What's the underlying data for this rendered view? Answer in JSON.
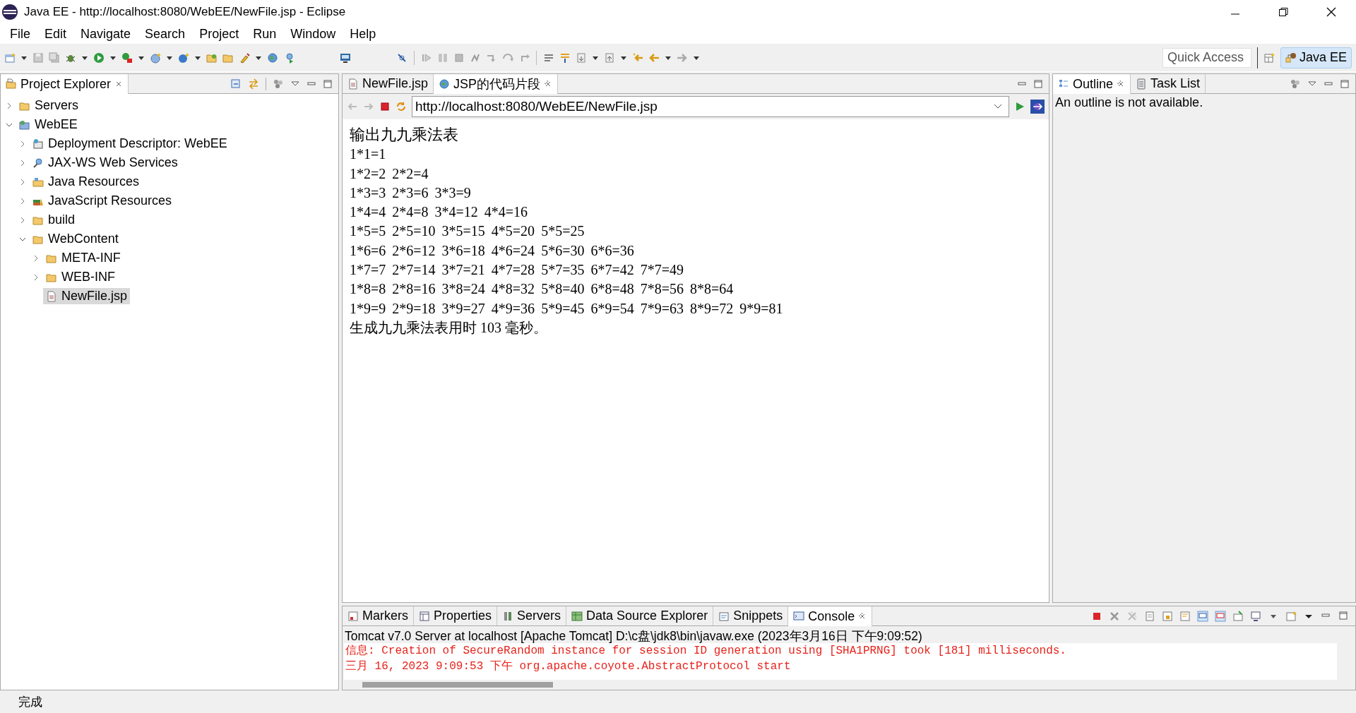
{
  "window": {
    "title": "Java EE - http://localhost:8080/WebEE/NewFile.jsp - Eclipse"
  },
  "menu": [
    "File",
    "Edit",
    "Navigate",
    "Search",
    "Project",
    "Run",
    "Window",
    "Help"
  ],
  "quick_access": {
    "placeholder": "Quick Access"
  },
  "perspective": {
    "label": "Java EE",
    "selected": true
  },
  "project_explorer": {
    "tab": "Project Explorer",
    "tree": [
      {
        "label": "Servers",
        "kind": "folder",
        "expanded": false,
        "selected": false
      },
      {
        "label": "WebEE",
        "kind": "project",
        "expanded": true,
        "selected": false,
        "children": [
          {
            "label": "Deployment Descriptor: WebEE",
            "kind": "descriptor",
            "expanded": false,
            "selected": false
          },
          {
            "label": "JAX-WS Web Services",
            "kind": "webservice",
            "expanded": false,
            "selected": false
          },
          {
            "label": "Java Resources",
            "kind": "java",
            "expanded": false,
            "selected": false
          },
          {
            "label": "JavaScript Resources",
            "kind": "script",
            "expanded": false,
            "selected": false
          },
          {
            "label": "build",
            "kind": "folder",
            "expanded": false,
            "selected": false
          },
          {
            "label": "WebContent",
            "kind": "folder",
            "expanded": true,
            "selected": false,
            "children": [
              {
                "label": "META-INF",
                "kind": "folder",
                "expanded": false,
                "selected": false
              },
              {
                "label": "WEB-INF",
                "kind": "folder",
                "expanded": false,
                "selected": false
              },
              {
                "label": "NewFile.jsp",
                "kind": "file",
                "selected": true
              }
            ]
          }
        ]
      }
    ]
  },
  "editor": {
    "tabs": [
      {
        "label": "NewFile.jsp",
        "selected": false
      },
      {
        "label": "JSP的代码片段",
        "selected": true
      }
    ],
    "url": "http://localhost:8080/WebEE/NewFile.jsp",
    "page": {
      "heading": "输出九九乘法表",
      "rows": [
        [
          "1*1=1"
        ],
        [
          "1*2=2",
          "2*2=4"
        ],
        [
          "1*3=3",
          "2*3=6",
          "3*3=9"
        ],
        [
          "1*4=4",
          "2*4=8",
          "3*4=12",
          "4*4=16"
        ],
        [
          "1*5=5",
          "2*5=10",
          "3*5=15",
          "4*5=20",
          "5*5=25"
        ],
        [
          "1*6=6",
          "2*6=12",
          "3*6=18",
          "4*6=24",
          "5*6=30",
          "6*6=36"
        ],
        [
          "1*7=7",
          "2*7=14",
          "3*7=21",
          "4*7=28",
          "5*7=35",
          "6*7=42",
          "7*7=49"
        ],
        [
          "1*8=8",
          "2*8=16",
          "3*8=24",
          "4*8=32",
          "5*8=40",
          "6*8=48",
          "7*8=56",
          "8*8=64"
        ],
        [
          "1*9=9",
          "2*9=18",
          "3*9=27",
          "4*9=36",
          "5*9=45",
          "6*9=54",
          "7*9=63",
          "8*9=72",
          "9*9=81"
        ]
      ],
      "footer": "生成九九乘法表用时 103 毫秒。"
    }
  },
  "outline": {
    "tabs": [
      {
        "label": "Outline",
        "selected": true
      },
      {
        "label": "Task List",
        "selected": false
      }
    ],
    "message": "An outline is not available."
  },
  "bottom_panel": {
    "tabs": [
      {
        "label": "Markers",
        "selected": false
      },
      {
        "label": "Properties",
        "selected": false
      },
      {
        "label": "Servers",
        "selected": false
      },
      {
        "label": "Data Source Explorer",
        "selected": false
      },
      {
        "label": "Snippets",
        "selected": false
      },
      {
        "label": "Console",
        "selected": true
      }
    ],
    "console_header": "Tomcat v7.0 Server at localhost [Apache Tomcat] D:\\c盘\\jdk8\\bin\\javaw.exe (2023年3月16日 下午9:09:52)",
    "console_lines": [
      "信息: Creation of SecureRandom instance for session ID generation using [SHA1PRNG] took [181] milliseconds.",
      "三月 16, 2023 9:09:53 下午 org.apache.coyote.AbstractProtocol start"
    ]
  },
  "status_bar": {
    "text": "完成"
  }
}
